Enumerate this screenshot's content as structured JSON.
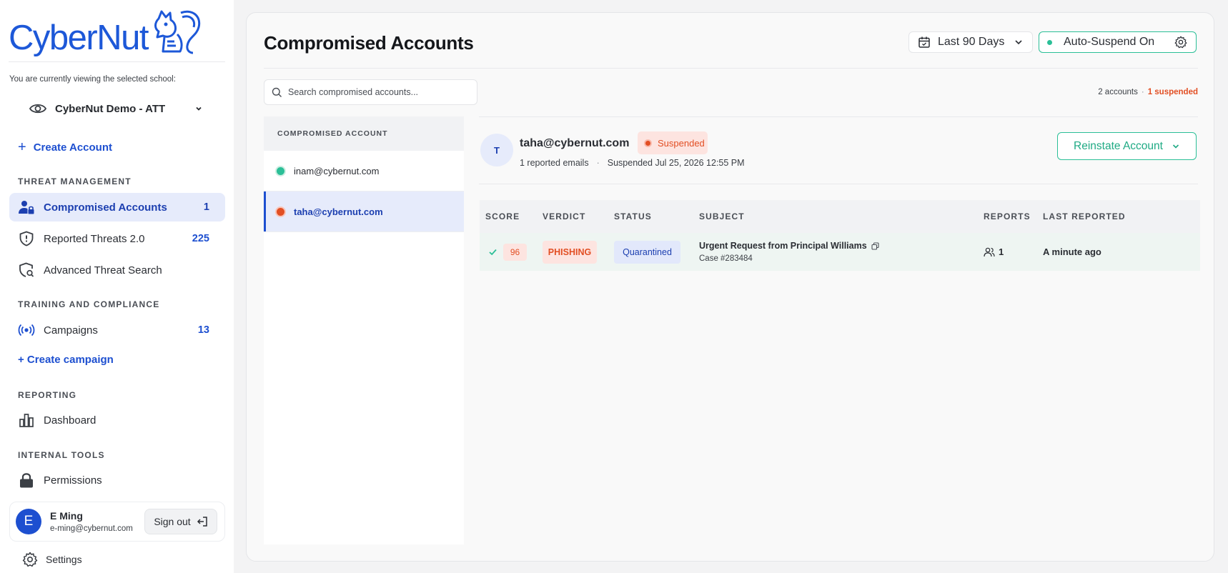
{
  "brand": {
    "name": "CyberNut",
    "accent": "#1d4fd0",
    "success": "#2bbf97",
    "danger": "#e24f24"
  },
  "sidebar": {
    "viewing_note": "You are currently viewing the selected school:",
    "school": "CyberNut Demo - ATT",
    "create_account": "Create Account",
    "sections": {
      "threat": "THREAT MANAGEMENT",
      "training": "TRAINING AND COMPLIANCE",
      "reporting": "REPORTING",
      "internal": "INTERNAL TOOLS"
    },
    "items": {
      "compromised": {
        "label": "Compromised Accounts",
        "count": "1",
        "icon": "user-lock-icon"
      },
      "reported": {
        "label": "Reported Threats 2.0",
        "count": "225",
        "icon": "shield-alert-icon"
      },
      "advanced": {
        "label": "Advanced Threat Search",
        "icon": "shield-search-icon"
      },
      "campaigns": {
        "label": "Campaigns",
        "count": "13",
        "icon": "broadcast-icon"
      },
      "dashboard": {
        "label": "Dashboard",
        "icon": "bar-chart-icon"
      },
      "permissions": {
        "label": "Permissions",
        "icon": "lock-icon"
      }
    },
    "create_campaign": "+ Create campaign",
    "user": {
      "initial": "E",
      "name": "E Ming",
      "email": "e-ming@cybernut.com",
      "signout": "Sign out"
    },
    "settings": "Settings"
  },
  "main": {
    "title": "Compromised Accounts",
    "date_filter": "Last 90 Days",
    "auto_suspend": "Auto-Suspend On",
    "search_placeholder": "Search compromised accounts...",
    "counts": {
      "accounts": "2 accounts",
      "sep": "·",
      "suspended": "1 suspended"
    },
    "list": {
      "header": "COMPROMISED ACCOUNT",
      "items": [
        {
          "email": "inam@cybernut.com",
          "status_color": "#2bbf97",
          "selected": false
        },
        {
          "email": "taha@cybernut.com",
          "status_color": "#e24f24",
          "selected": true
        }
      ]
    },
    "detail": {
      "initial": "T",
      "email": "taha@cybernut.com",
      "status": "Suspended",
      "reported": "1 reported emails",
      "sep": "·",
      "suspended_at": "Suspended Jul 25, 2026 12:55 PM",
      "reinstate": "Reinstate Account"
    },
    "table": {
      "columns": [
        "SCORE",
        "VERDICT",
        "STATUS",
        "SUBJECT",
        "REPORTS",
        "LAST REPORTED"
      ],
      "rows": [
        {
          "score": "96",
          "verdict": "PHISHING",
          "status": "Quarantined",
          "subject": "Urgent Request from Principal Williams",
          "case": "Case #283484",
          "reports": "1",
          "last_reported": "A minute ago"
        }
      ]
    }
  }
}
